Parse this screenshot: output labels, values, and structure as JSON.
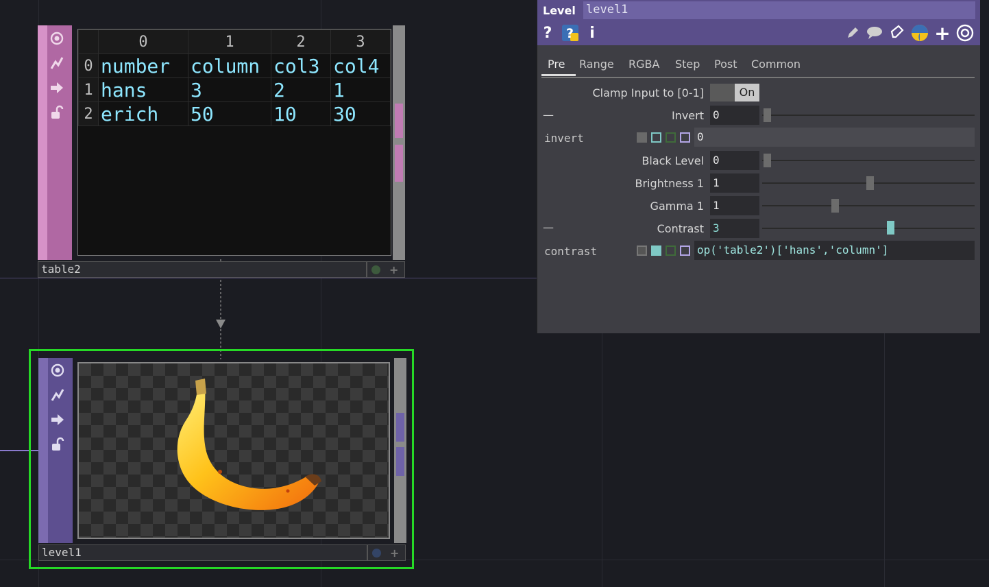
{
  "table_node": {
    "name": "table2",
    "col_headers": [
      "",
      "0",
      "1",
      "2",
      "3"
    ],
    "rows": [
      {
        "index": "0",
        "cells": [
          "number",
          "column",
          "col3",
          "col4"
        ]
      },
      {
        "index": "1",
        "cells": [
          "hans",
          "3",
          "2",
          "1"
        ]
      },
      {
        "index": "2",
        "cells": [
          "erich",
          "50",
          "10",
          "30"
        ]
      }
    ],
    "strip_icons": [
      "viewer-icon",
      "bypass-icon",
      "export-icon",
      "lock-icon"
    ]
  },
  "level_node": {
    "name": "level1",
    "strip_icons": [
      "viewer-icon",
      "bypass-icon",
      "export-icon",
      "lock-icon"
    ]
  },
  "panel": {
    "type_label": "Level",
    "node_name": "level1",
    "tools_left": [
      "help-icon",
      "python-help-icon",
      "info-icon"
    ],
    "tools_right": [
      "edit-icon",
      "comment-icon",
      "copy-icon",
      "python-icon",
      "add-icon",
      "target-icon"
    ],
    "tabs": [
      "Pre",
      "Range",
      "RGBA",
      "Step",
      "Post",
      "Common"
    ],
    "active_tab": "Pre",
    "params": {
      "clamp": {
        "label": "Clamp Input to [0-1]",
        "value": "On"
      },
      "invert": {
        "label": "Invert",
        "value": "0",
        "name": "invert",
        "expr": "0",
        "slider": 0.0
      },
      "black_level": {
        "label": "Black Level",
        "value": "0",
        "slider": 0.0
      },
      "brightness": {
        "label": "Brightness 1",
        "value": "1",
        "slider": 0.5
      },
      "gamma": {
        "label": "Gamma 1",
        "value": "1",
        "slider": 0.33
      },
      "contrast": {
        "label": "Contrast",
        "value": "3",
        "name": "contrast",
        "expr": "op('table2')['hans','column']",
        "slider": 0.6
      }
    },
    "dash": "—"
  },
  "colors": {
    "background": "#1b1c22",
    "table_strip": "#d792c8",
    "level_strip": "#7c6bb0",
    "selection": "#26d926",
    "panel_header": "#5a4e8a",
    "cell_text": "#8ee7ff",
    "active_slider": "#7fc9c5"
  }
}
